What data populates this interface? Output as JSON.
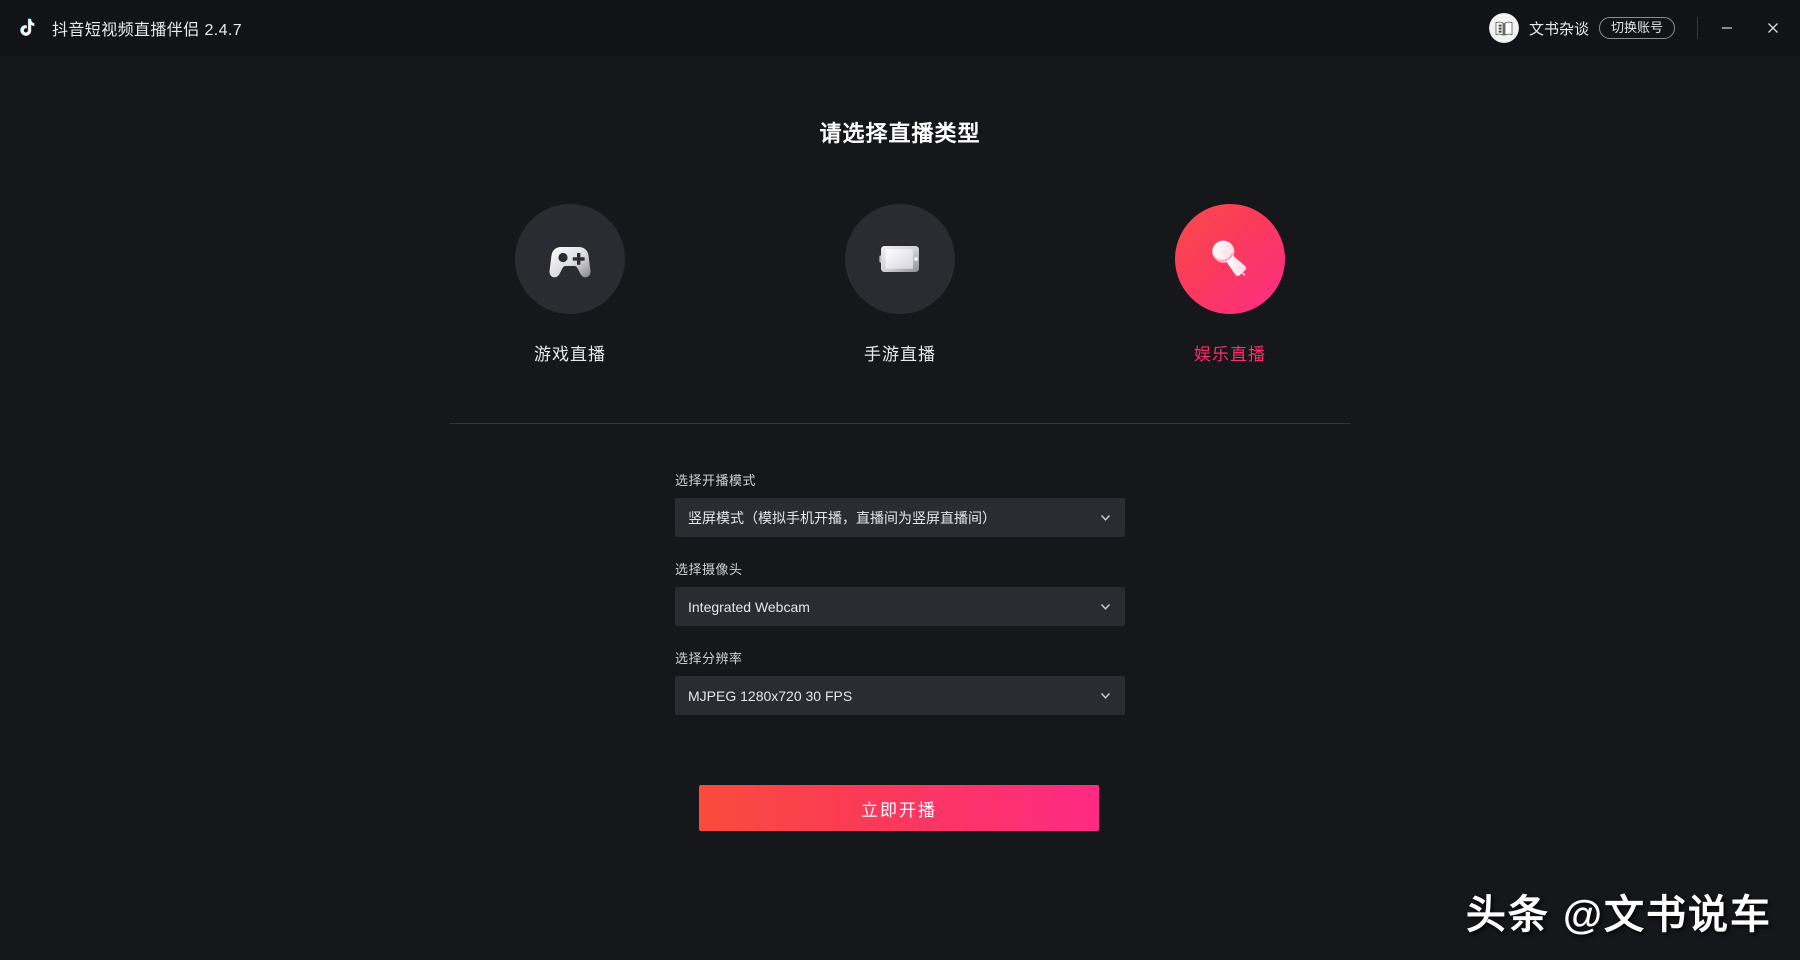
{
  "titlebar": {
    "logo_icon": "tiktok-note-icon",
    "app_title": "抖音短视频直播伴侣 2.4.7",
    "avatar_icon": "open-book-avatar",
    "username": "文书杂谈",
    "switch_account_label": "切换账号",
    "minimize_icon": "minimize-icon",
    "close_icon": "close-icon"
  },
  "main": {
    "headline": "请选择直播类型",
    "stream_types": [
      {
        "label": "游戏直播",
        "icon": "gamepad-icon",
        "selected": false
      },
      {
        "label": "手游直播",
        "icon": "phone-landscape-icon",
        "selected": false
      },
      {
        "label": "娱乐直播",
        "icon": "microphone-icon",
        "selected": true
      }
    ],
    "form": {
      "mode": {
        "label": "选择开播模式",
        "value": "竖屏模式（模拟手机开播，直播间为竖屏直播间）"
      },
      "camera": {
        "label": "选择摄像头",
        "value": "Integrated Webcam"
      },
      "resolution": {
        "label": "选择分辨率",
        "value": "MJPEG 1280x720 30 FPS"
      },
      "chevron_icon": "chevron-down-icon"
    },
    "cta_label": "立即开播"
  },
  "watermark": "头条 @文书说车",
  "colors": {
    "page_bg": "#16171b",
    "titlebar_bg": "#121317",
    "field_bg": "#2b2c31",
    "accent_pink": "#fe2c6e",
    "accent_red": "#fa4b3c",
    "text_primary": "#e9e9ec",
    "text_secondary": "#cfcfd4"
  }
}
